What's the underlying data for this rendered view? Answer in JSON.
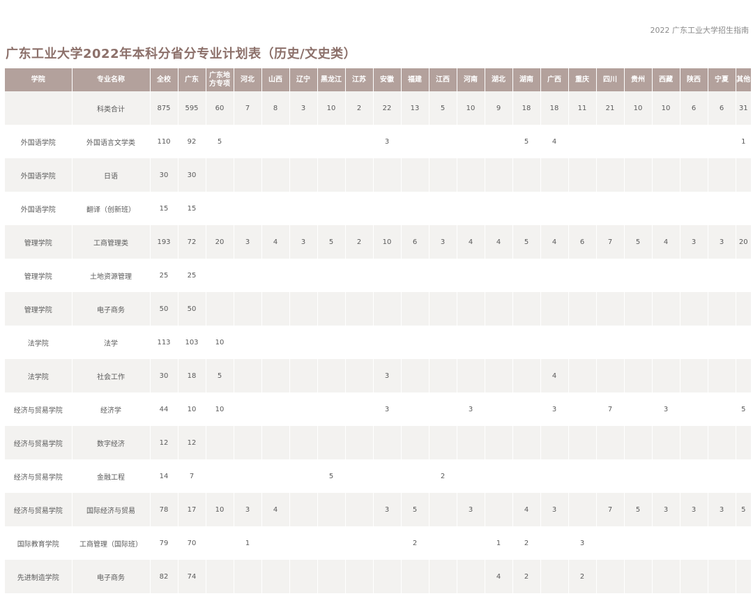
{
  "header": {
    "running_title": "2022 广东工业大学招生指南"
  },
  "title": "广东工业大学2022年本科分省分专业计划表（历史/文史类）",
  "table": {
    "columns": [
      "学院",
      "专业名称",
      "全校",
      "广东",
      "广东地方专项",
      "河北",
      "山西",
      "辽宁",
      "黑龙江",
      "江苏",
      "安徽",
      "福建",
      "江西",
      "河南",
      "湖北",
      "湖南",
      "广西",
      "重庆",
      "四川",
      "贵州",
      "西藏",
      "陕西",
      "宁夏",
      "其他"
    ],
    "rows": [
      [
        "",
        "科类合计",
        "875",
        "595",
        "60",
        "7",
        "8",
        "3",
        "10",
        "2",
        "22",
        "13",
        "5",
        "10",
        "9",
        "18",
        "18",
        "11",
        "21",
        "10",
        "10",
        "6",
        "6",
        "31"
      ],
      [
        "外国语学院",
        "外国语言文学类",
        "110",
        "92",
        "5",
        "",
        "",
        "",
        "",
        "",
        "3",
        "",
        "",
        "",
        "",
        "5",
        "4",
        "",
        "",
        "",
        "",
        "",
        "",
        "1"
      ],
      [
        "外国语学院",
        "日语",
        "30",
        "30",
        "",
        "",
        "",
        "",
        "",
        "",
        "",
        "",
        "",
        "",
        "",
        "",
        "",
        "",
        "",
        "",
        "",
        "",
        "",
        ""
      ],
      [
        "外国语学院",
        "翻译（创新班）",
        "15",
        "15",
        "",
        "",
        "",
        "",
        "",
        "",
        "",
        "",
        "",
        "",
        "",
        "",
        "",
        "",
        "",
        "",
        "",
        "",
        "",
        ""
      ],
      [
        "管理学院",
        "工商管理类",
        "193",
        "72",
        "20",
        "3",
        "4",
        "3",
        "5",
        "2",
        "10",
        "6",
        "3",
        "4",
        "4",
        "5",
        "4",
        "6",
        "7",
        "5",
        "4",
        "3",
        "3",
        "20"
      ],
      [
        "管理学院",
        "土地资源管理",
        "25",
        "25",
        "",
        "",
        "",
        "",
        "",
        "",
        "",
        "",
        "",
        "",
        "",
        "",
        "",
        "",
        "",
        "",
        "",
        "",
        "",
        ""
      ],
      [
        "管理学院",
        "电子商务",
        "50",
        "50",
        "",
        "",
        "",
        "",
        "",
        "",
        "",
        "",
        "",
        "",
        "",
        "",
        "",
        "",
        "",
        "",
        "",
        "",
        "",
        ""
      ],
      [
        "法学院",
        "法学",
        "113",
        "103",
        "10",
        "",
        "",
        "",
        "",
        "",
        "",
        "",
        "",
        "",
        "",
        "",
        "",
        "",
        "",
        "",
        "",
        "",
        "",
        ""
      ],
      [
        "法学院",
        "社会工作",
        "30",
        "18",
        "5",
        "",
        "",
        "",
        "",
        "",
        "3",
        "",
        "",
        "",
        "",
        "",
        "4",
        "",
        "",
        "",
        "",
        "",
        "",
        ""
      ],
      [
        "经济与贸易学院",
        "经济学",
        "44",
        "10",
        "10",
        "",
        "",
        "",
        "",
        "",
        "3",
        "",
        "",
        "3",
        "",
        "",
        "3",
        "",
        "7",
        "",
        "3",
        "",
        "",
        "5"
      ],
      [
        "经济与贸易学院",
        "数字经济",
        "12",
        "12",
        "",
        "",
        "",
        "",
        "",
        "",
        "",
        "",
        "",
        "",
        "",
        "",
        "",
        "",
        "",
        "",
        "",
        "",
        "",
        ""
      ],
      [
        "经济与贸易学院",
        "金融工程",
        "14",
        "7",
        "",
        "",
        "",
        "",
        "5",
        "",
        "",
        "",
        "2",
        "",
        "",
        "",
        "",
        "",
        "",
        "",
        "",
        "",
        "",
        ""
      ],
      [
        "经济与贸易学院",
        "国际经济与贸易",
        "78",
        "17",
        "10",
        "3",
        "4",
        "",
        "",
        "",
        "3",
        "5",
        "",
        "3",
        "",
        "4",
        "3",
        "",
        "7",
        "5",
        "3",
        "3",
        "3",
        "5"
      ],
      [
        "国际教育学院",
        "工商管理（国际班）",
        "79",
        "70",
        "",
        "1",
        "",
        "",
        "",
        "",
        "",
        "2",
        "",
        "",
        "1",
        "2",
        "",
        "3",
        "",
        "",
        "",
        "",
        "",
        ""
      ],
      [
        "先进制造学院",
        "电子商务",
        "82",
        "74",
        "",
        "",
        "",
        "",
        "",
        "",
        "",
        "",
        "",
        "",
        "4",
        "2",
        "",
        "2",
        "",
        "",
        "",
        "",
        "",
        ""
      ]
    ]
  }
}
